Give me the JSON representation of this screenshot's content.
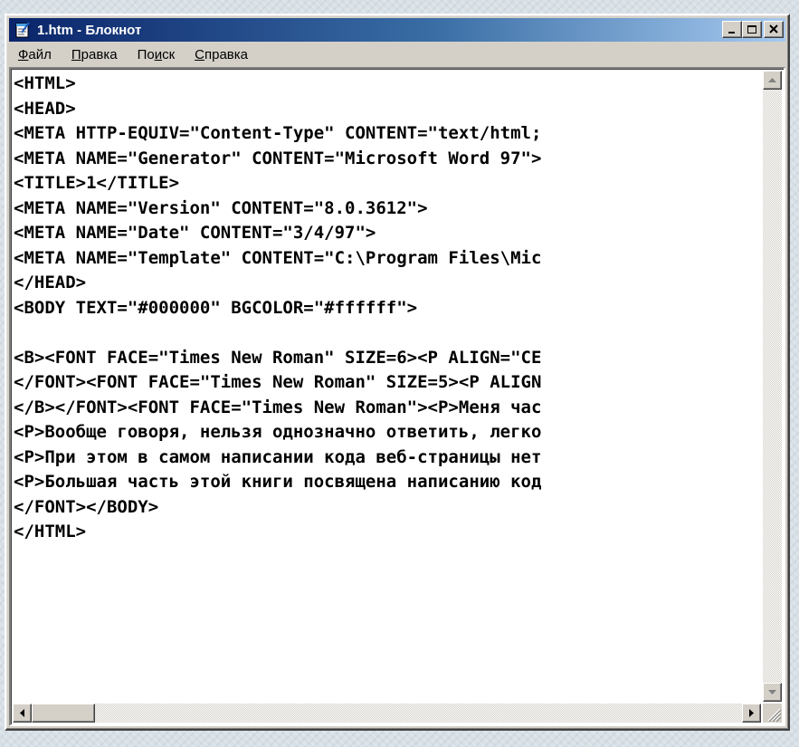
{
  "window": {
    "title": "1.htm - Блокнот",
    "minimize_icon": "minimize-icon",
    "maximize_icon": "maximize-icon",
    "close_icon": "close-icon"
  },
  "menu": {
    "items": [
      {
        "label": "Файл",
        "accel": "Ф"
      },
      {
        "label": "Правка",
        "accel": "П"
      },
      {
        "label": "Поиск",
        "accel": "и"
      },
      {
        "label": "Справка",
        "accel": "С"
      }
    ]
  },
  "editor": {
    "lines": [
      "<HTML>",
      "<HEAD>",
      "<META HTTP-EQUIV=\"Content-Type\" CONTENT=\"text/html;",
      "<META NAME=\"Generator\" CONTENT=\"Microsoft Word 97\">",
      "<TITLE>1</TITLE>",
      "<META NAME=\"Version\" CONTENT=\"8.0.3612\">",
      "<META NAME=\"Date\" CONTENT=\"3/4/97\">",
      "<META NAME=\"Template\" CONTENT=\"C:\\Program Files\\Mic",
      "</HEAD>",
      "<BODY TEXT=\"#000000\" BGCOLOR=\"#ffffff\">",
      "",
      "<B><FONT FACE=\"Times New Roman\" SIZE=6><P ALIGN=\"CE",
      "</FONT><FONT FACE=\"Times New Roman\" SIZE=5><P ALIGN",
      "</B></FONT><FONT FACE=\"Times New Roman\"><P>Меня час",
      "<P>Вообще говоря, нельзя однозначно ответить, легко",
      "<P>При этом в самом написании кода веб-страницы нет",
      "<P>Большая часть этой книги посвящена написанию код",
      "</FONT></BODY>",
      "</HTML>"
    ]
  },
  "colors": {
    "titlebar_start": "#0a246a",
    "titlebar_end": "#a6caf0",
    "chrome": "#d4d0c8",
    "editor_bg": "#ffffff"
  }
}
